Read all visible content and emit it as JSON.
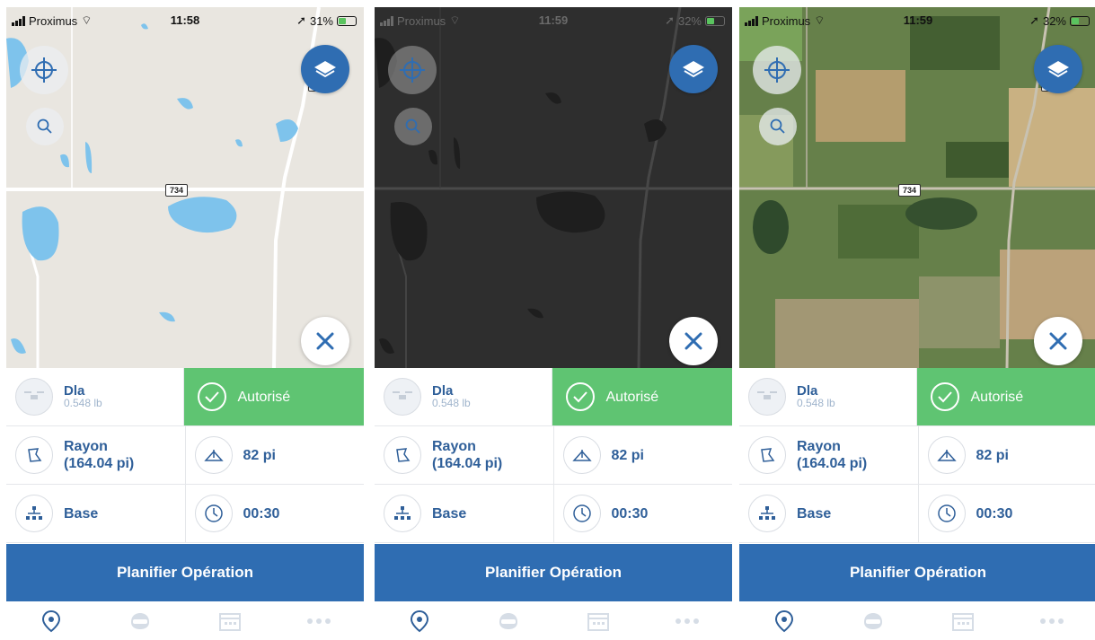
{
  "screens": [
    {
      "theme": "light",
      "status": {
        "carrier": "Proximus",
        "time": "11:58",
        "battery": "31%"
      },
      "road_labels": {
        "main": "734",
        "secondary": "36"
      }
    },
    {
      "theme": "dark",
      "status": {
        "carrier": "Proximus",
        "time": "11:59",
        "battery": "32%"
      },
      "road_labels": {
        "main": "734",
        "secondary": "36"
      }
    },
    {
      "theme": "satellite",
      "status": {
        "carrier": "Proximus",
        "time": "11:59",
        "battery": "32%"
      },
      "road_labels": {
        "main": "734",
        "secondary": "36"
      }
    }
  ],
  "panel": {
    "drone_name": "Dla",
    "drone_weight": "0.548 lb",
    "status_label": "Autorisé",
    "radius_label": "Rayon",
    "radius_value": "(164.04 pi)",
    "altitude": "82 pi",
    "mode": "Base",
    "duration": "00:30"
  },
  "plan_button": "Planifier Opération",
  "tabs": [
    "map-pin-icon",
    "pilot-helmet-icon",
    "calendar-icon",
    "more-dots-icon"
  ],
  "colors": {
    "primary": "#2f6db2",
    "authorized": "#5fc472",
    "text_blue": "#2f5f99",
    "water": "#7ec3ec"
  }
}
